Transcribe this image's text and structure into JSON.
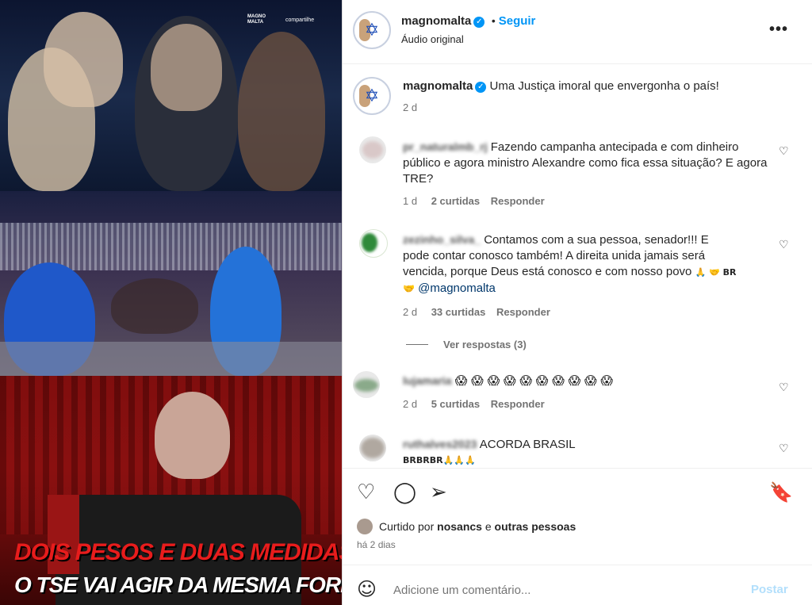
{
  "media": {
    "logo_text": "MAGNO MALTA",
    "share_text": "compartilhe",
    "headline_line1": "DOIS PESOS E DUAS MEDIDAS!",
    "headline_line2": "O TSE VAI AGIR DA MESMA FORMA?"
  },
  "header": {
    "username": "magnomalta",
    "dot": "•",
    "follow_label": "Seguir",
    "audio_label": "Áudio original",
    "more_icon": "more-options-icon"
  },
  "caption": {
    "username": "magnomalta",
    "text": "Uma Justiça imoral que envergonha o país!",
    "time": "2 d"
  },
  "comments": [
    {
      "username": "pr_naturalmb_rj",
      "text": "Fazendo campanha antecipada e com dinheiro público e agora ministro Alexandre como fica essa situação? E agora TRE?",
      "time": "1 d",
      "likes": "2 curtidas",
      "reply": "Responder"
    },
    {
      "username": "zezinho_silva_",
      "text_line1": "Contamos com a sua pessoa, senador!!! E",
      "text_line2": "pode contar conosco também! A direita unida jamais será",
      "text_line3": "vencida, porque Deus está conosco e com nosso povo",
      "text_suffix": "🙏 🤝 BR",
      "mention": "@magnomalta",
      "mention_prefix": "🤝",
      "time": "2 d",
      "likes": "33 curtidas",
      "reply": "Responder",
      "view_replies": "Ver respostas (3)"
    },
    {
      "username": "lujamaria",
      "text": "😱 😱 😱 😱 😱 😱 😱 😱 😱 😱",
      "time": "2 d",
      "likes": "5 curtidas",
      "reply": "Responder"
    },
    {
      "username": "ruthalves2023",
      "text": "ACORDA BRASIL",
      "text_line2": "BRBRBR🙏🙏🙏"
    }
  ],
  "actions": {
    "like_icon": "heart-icon",
    "comment_icon": "comment-icon",
    "share_icon": "share-icon",
    "save_icon": "bookmark-icon"
  },
  "likes_line": {
    "prefix": "Curtido por",
    "user": "nosancs",
    "conj": "e",
    "others": "outras pessoas"
  },
  "post_time": "há 2 dias",
  "composer": {
    "placeholder": "Adicione um comentário...",
    "post_label": "Postar",
    "emoji_icon": "emoji-icon"
  }
}
